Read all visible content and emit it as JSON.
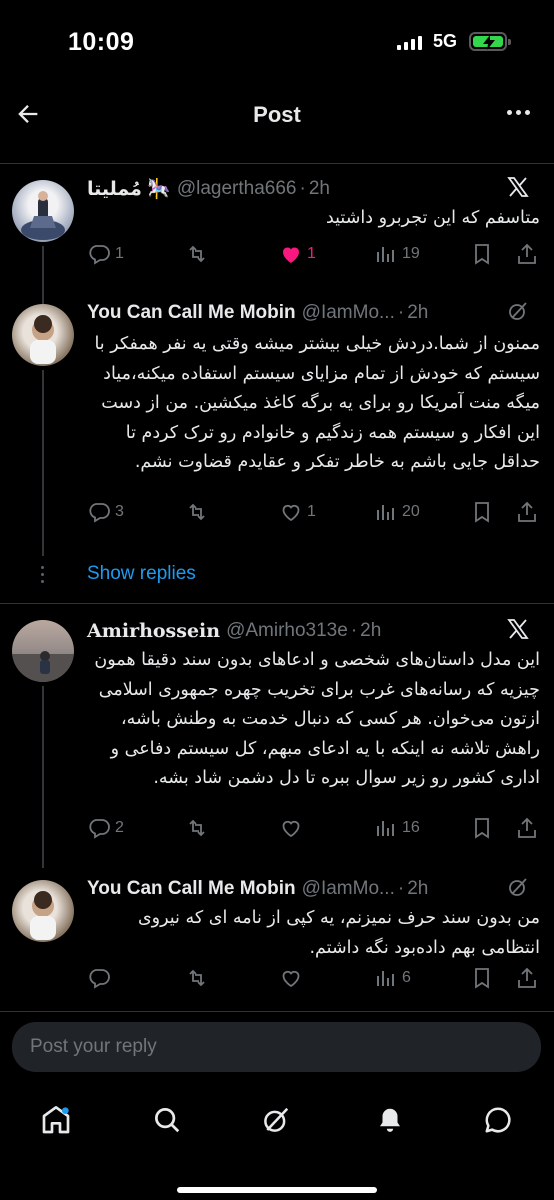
{
  "status_bar": {
    "time": "10:09",
    "network": "5G"
  },
  "header": {
    "title": "Post"
  },
  "tweets": [
    {
      "name": "مُملیتا 🎠",
      "handle": "@lagertha666",
      "sep": "·",
      "time": "2h",
      "text": "متاسفم که این تجربرو داشتید",
      "replies": "1",
      "retweets": "",
      "likes": "1",
      "views": "19"
    },
    {
      "name": "You Can Call Me Mobin",
      "handle": "@IamMo...",
      "sep": "·",
      "time": "2h",
      "text": "ممنون از شما.دردش خیلی بیشتر میشه وقتی یه نفر همفکر با سیستم که خودش از تمام مزایای سیستم استفاده میکنه،میاد میگه منت آمریکا رو برای یه برگه کاغذ میکشین. من از دست این افکار و سیستم همه زندگیم و خانوادم رو ترک کردم تا حداقل جایی باشم به خاطر تفکر و عقایدم قضاوت نشم.",
      "replies": "3",
      "retweets": "",
      "likes": "1",
      "views": "20"
    },
    {
      "name": "Amirhossein",
      "handle": "@Amirho313e",
      "sep": "·",
      "time": "2h",
      "text": "این مدل داستان‌های شخصی و ادعاهای بدون سند دقیقا همون چیزیه که رسانه‌های غرب برای تخریب چهره جمهوری اسلامی ازتون می‌خوان. هر کسی که دنبال خدمت به وطنش باشه، راهش تلاشه نه اینکه با یه ادعای مبهم، کل سیستم دفاعی و اداری کشور رو زیر سوال ببره تا دل دشمن شاد بشه.",
      "replies": "2",
      "retweets": "",
      "likes": "",
      "views": "16"
    },
    {
      "name": "You Can Call Me Mobin",
      "handle": "@IamMo...",
      "sep": "·",
      "time": "2h",
      "text": "من بدون سند حرف نمیزنم، یه کپی از نامه ای که نیروی انتظامی بهم داده‌بود نگه داشتم.",
      "replies": "",
      "retweets": "",
      "likes": "",
      "views": "6"
    }
  ],
  "show_replies": "Show replies",
  "reply_box": {
    "placeholder": "Post your reply"
  },
  "colors": {
    "like_active": "#f91880",
    "link": "#1d9bf0",
    "battery": "#32d74b"
  }
}
